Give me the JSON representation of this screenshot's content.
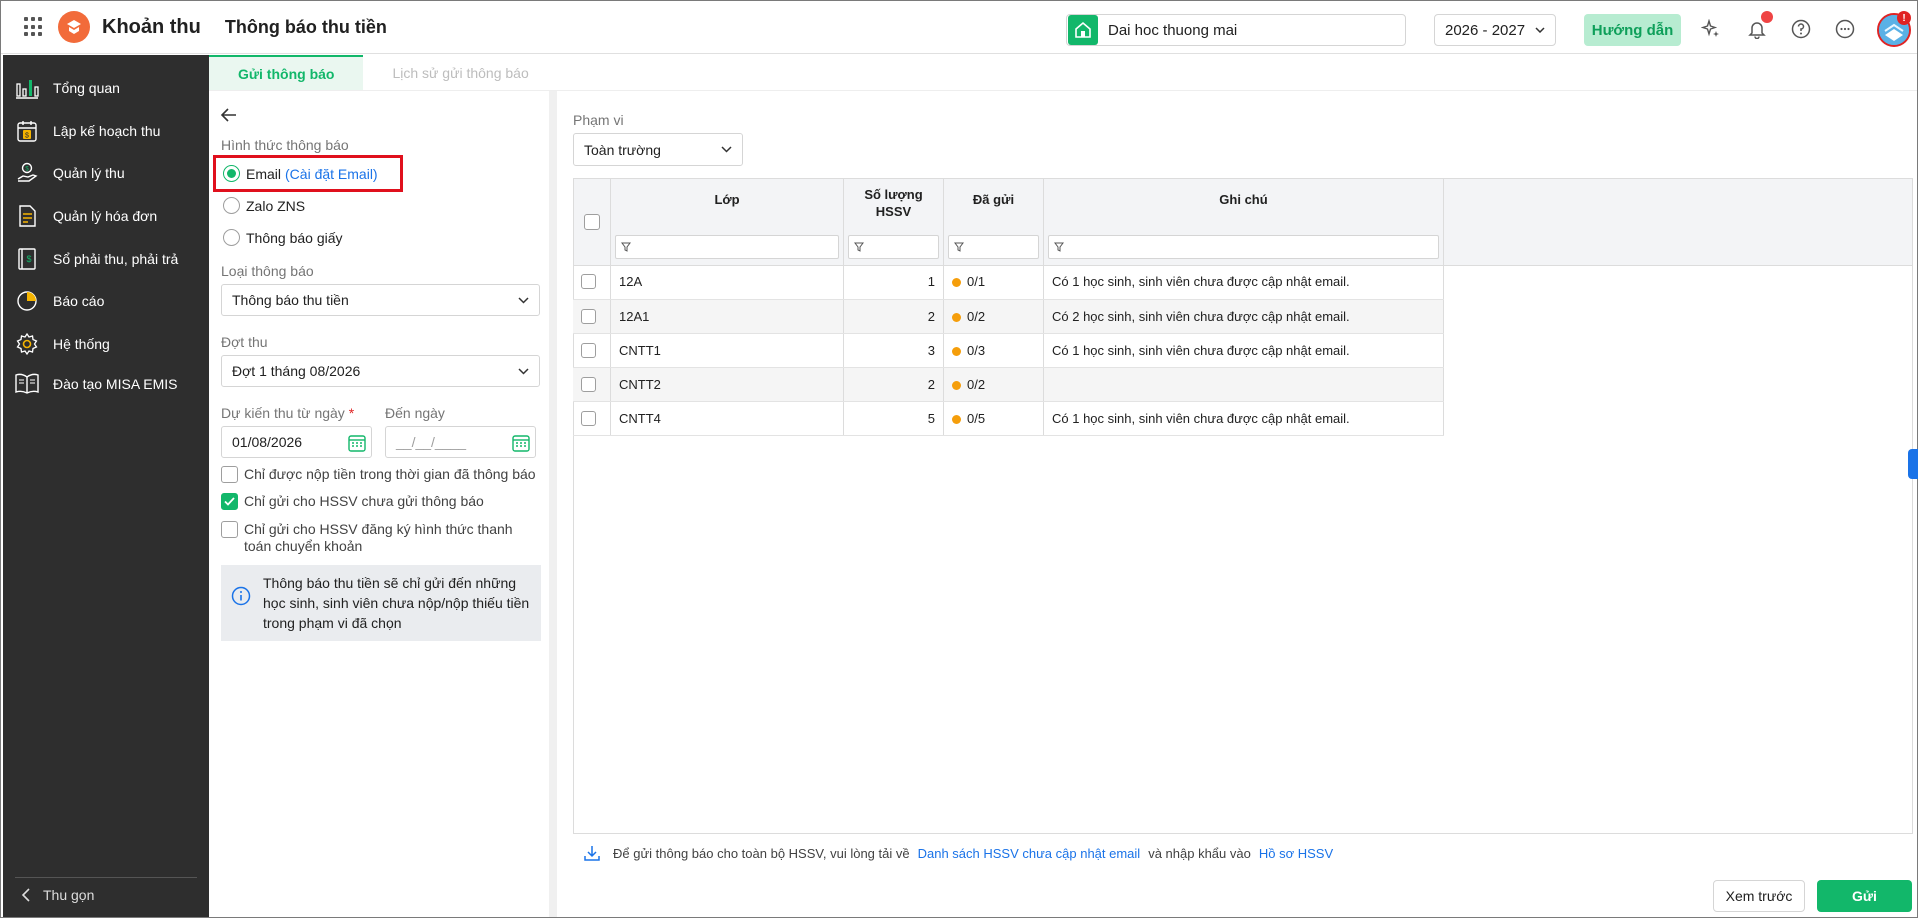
{
  "header": {
    "app_name": "Khoản thu",
    "page_title": "Thông báo thu tiền",
    "school_name": "Dai hoc thuong mai",
    "school_year": "2026 - 2027",
    "guide_label": "Hướng dẫn",
    "avatar_badge": "!"
  },
  "sidebar": {
    "items": [
      {
        "label": "Tổng quan",
        "icon": "chart-bars-icon"
      },
      {
        "label": "Lập kế hoạch thu",
        "icon": "calendar-dollar-icon"
      },
      {
        "label": "Quản lý thu",
        "icon": "hand-coin-icon"
      },
      {
        "label": "Quản lý hóa đơn",
        "icon": "invoice-icon"
      },
      {
        "label": "Sổ phải thu, phải trả",
        "icon": "ledger-icon"
      },
      {
        "label": "Báo cáo",
        "icon": "pie-chart-icon"
      },
      {
        "label": "Hệ thống",
        "icon": "gear-icon"
      },
      {
        "label": "Đào tạo MISA EMIS",
        "icon": "book-icon"
      }
    ],
    "collapse_label": "Thu gọn"
  },
  "tabs": [
    {
      "label": "Gửi thông báo",
      "active": true
    },
    {
      "label": "Lịch sử gửi thông báo",
      "active": false
    }
  ],
  "form": {
    "method_label": "Hình thức thông báo",
    "methods": [
      {
        "label": "Email",
        "link": "(Cài đặt Email)",
        "selected": true
      },
      {
        "label": "Zalo ZNS",
        "link": "",
        "selected": false
      },
      {
        "label": "Thông báo giấy",
        "link": "",
        "selected": false
      }
    ],
    "type_label": "Loại thông báo",
    "type_value": "Thông báo thu tiền",
    "period_label": "Đợt thu",
    "period_value": "Đợt 1 tháng 08/2026",
    "from_label": "Dự kiến thu từ ngày",
    "required_mark": "*",
    "to_label": "Đến ngày",
    "from_value": "01/08/2026",
    "to_placeholder": "__/__/____",
    "checkboxes": [
      {
        "label": "Chỉ được nộp tiền trong thời gian đã thông báo",
        "checked": false
      },
      {
        "label": "Chỉ gửi cho HSSV chưa gửi thông báo",
        "checked": true
      },
      {
        "label": "Chỉ gửi cho HSSV đăng ký hình thức thanh toán chuyển khoản",
        "checked": false
      }
    ],
    "info_text": "Thông báo thu tiền sẽ chỉ gửi đến những học sinh, sinh viên chưa nộp/nộp thiếu tiền trong phạm vi đã chọn"
  },
  "scope": {
    "label": "Phạm vi",
    "value": "Toàn trường"
  },
  "table": {
    "headers": {
      "class": "Lớp",
      "count": "Số lượng HSSV",
      "sent": "Đã gửi",
      "note": "Ghi chú"
    },
    "rows": [
      {
        "class": "12A",
        "count": "1",
        "sent": "0/1",
        "note": "Có 1 học sinh, sinh viên chưa được cập nhật email."
      },
      {
        "class": "12A1",
        "count": "2",
        "sent": "0/2",
        "note": "Có 2 học sinh, sinh viên chưa được cập nhật email."
      },
      {
        "class": "CNTT1",
        "count": "3",
        "sent": "0/3",
        "note": "Có 1 học sinh, sinh viên chưa được cập nhật email."
      },
      {
        "class": "CNTT2",
        "count": "2",
        "sent": "0/2",
        "note": ""
      },
      {
        "class": "CNTT4",
        "count": "5",
        "sent": "0/5",
        "note": "Có 1 học sinh, sinh viên chưa được cập nhật email."
      }
    ]
  },
  "footer": {
    "note_prefix": "Để gửi thông báo cho toàn bộ HSSV, vui lòng tải về",
    "note_link1": "Danh sách HSSV chưa cập nhật email",
    "note_middle": "và nhập khẩu vào",
    "note_link2": "Hồ sơ HSSV",
    "preview_label": "Xem trước",
    "send_label": "Gửi"
  },
  "colors": {
    "accent": "#12b76a",
    "sidebar_bg": "#2e2e2e",
    "link": "#1a73e8",
    "status_dot": "#f59e0b",
    "highlight": "#e0101d"
  }
}
